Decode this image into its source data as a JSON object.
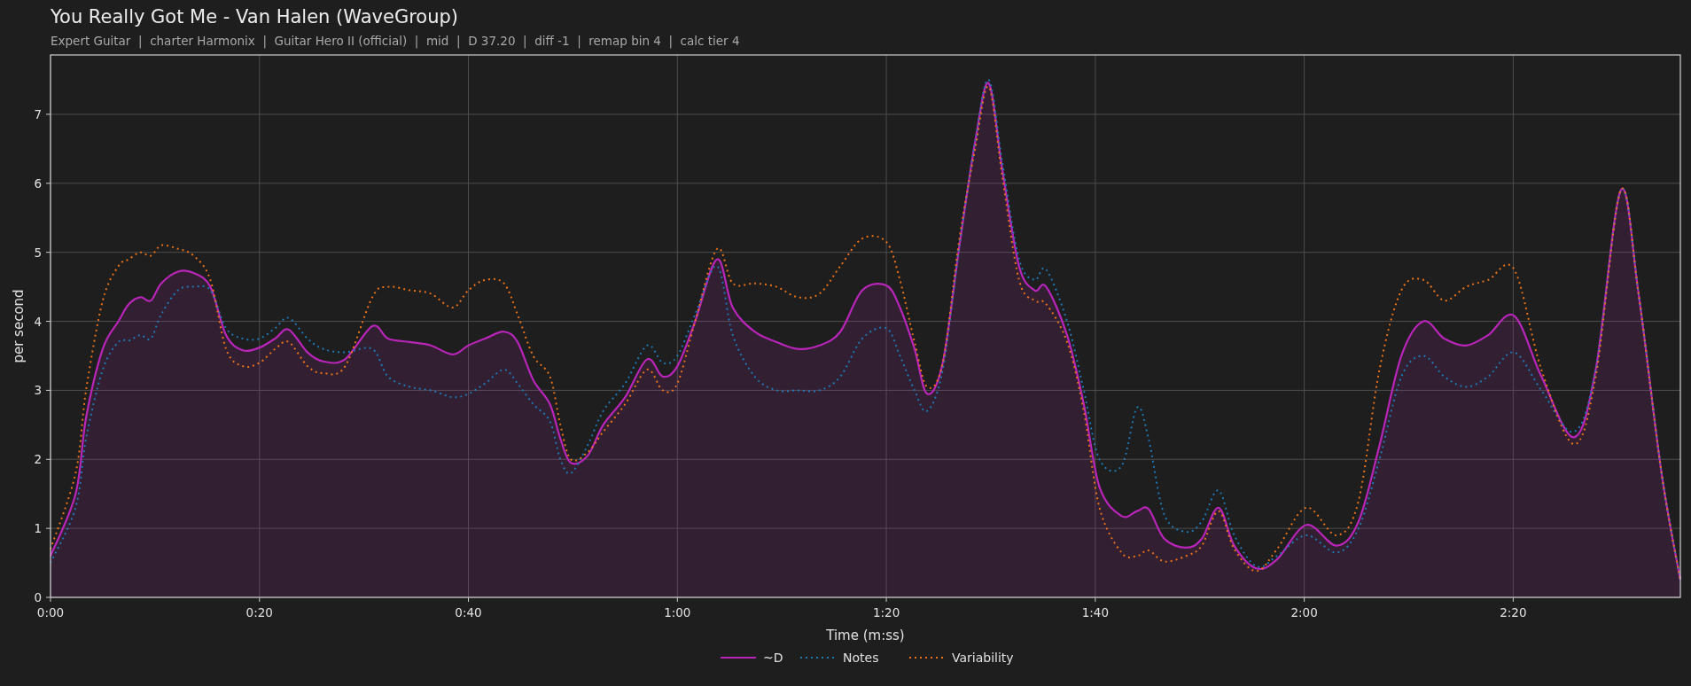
{
  "title": "You Really Got Me - Van Halen (WaveGroup)",
  "subtitle": "Expert Guitar  |  charter Harmonix  |  Guitar Hero II (official)  |  mid  |  D 37.20  |  diff -1  |  remap bin 4  |  calc tier 4",
  "chart_data": {
    "type": "line",
    "xlabel": "Time (m:ss)",
    "ylabel": "per second",
    "xlim": [
      0,
      156
    ],
    "ylim": [
      0,
      7.86
    ],
    "xticks": [
      {
        "value": 0,
        "label": "0:00"
      },
      {
        "value": 20,
        "label": "0:20"
      },
      {
        "value": 40,
        "label": "0:40"
      },
      {
        "value": 60,
        "label": "1:00"
      },
      {
        "value": 80,
        "label": "1:20"
      },
      {
        "value": 100,
        "label": "1:40"
      },
      {
        "value": 120,
        "label": "2:00"
      },
      {
        "value": 140,
        "label": "2:20"
      }
    ],
    "yticks": [
      0,
      1,
      2,
      3,
      4,
      5,
      6,
      7
    ],
    "grid": true,
    "legend": true,
    "x": [
      0,
      2.4,
      3.4,
      5,
      6.5,
      7.5,
      8.6,
      9.6,
      10.6,
      12.2,
      13.7,
      15.3,
      16.8,
      18.4,
      20,
      21.5,
      22.8,
      24.6,
      26.1,
      28.2,
      30.8,
      32.3,
      34.4,
      36.4,
      38.5,
      40,
      41.6,
      43.4,
      44.7,
      46.2,
      47.8,
      48.8,
      49.8,
      51.4,
      52.9,
      55,
      57.1,
      58.6,
      60,
      61.7,
      63.8,
      65.3,
      67.4,
      69.5,
      71.5,
      73.6,
      75.6,
      77.7,
      80,
      81.3,
      82.7,
      83.9,
      85.4,
      87,
      88.5,
      89.8,
      91.1,
      92.7,
      94.2,
      95.3,
      97.3,
      98.9,
      100.4,
      102.5,
      104,
      105.1,
      106.6,
      108.7,
      110.2,
      111.8,
      113.3,
      115.4,
      117.4,
      120.2,
      123.1,
      125.2,
      127.2,
      129.3,
      131.4,
      133.4,
      135.5,
      137.6,
      140.1,
      142.7,
      145.8,
      147.9,
      150.3,
      152,
      154.2,
      156
    ],
    "series": [
      {
        "name": "~D",
        "color": "#b825b8",
        "type": "area",
        "line_style": "solid",
        "values": [
          0.6,
          1.5,
          2.6,
          3.6,
          4.0,
          4.25,
          4.35,
          4.3,
          4.55,
          4.72,
          4.7,
          4.5,
          3.8,
          3.58,
          3.62,
          3.75,
          3.88,
          3.55,
          3.42,
          3.45,
          3.93,
          3.75,
          3.7,
          3.65,
          3.52,
          3.65,
          3.75,
          3.85,
          3.7,
          3.15,
          2.8,
          2.3,
          1.95,
          2.05,
          2.5,
          2.9,
          3.45,
          3.2,
          3.35,
          4.0,
          4.9,
          4.2,
          3.85,
          3.7,
          3.6,
          3.65,
          3.85,
          4.45,
          4.52,
          4.2,
          3.6,
          2.95,
          3.4,
          5.1,
          6.6,
          7.45,
          6.2,
          4.8,
          4.45,
          4.5,
          3.8,
          2.8,
          1.6,
          1.18,
          1.25,
          1.28,
          0.85,
          0.72,
          0.85,
          1.3,
          0.75,
          0.42,
          0.55,
          1.05,
          0.75,
          1.1,
          2.2,
          3.5,
          4.0,
          3.75,
          3.65,
          3.8,
          4.08,
          3.2,
          2.32,
          3.3,
          5.9,
          4.4,
          1.8,
          0.25
        ]
      },
      {
        "name": "Notes",
        "color": "#1f77b4",
        "line_style": "dotted",
        "values": [
          0.5,
          1.3,
          2.3,
          3.3,
          3.7,
          3.72,
          3.8,
          3.75,
          4.1,
          4.45,
          4.5,
          4.45,
          3.9,
          3.75,
          3.75,
          3.9,
          4.05,
          3.75,
          3.6,
          3.55,
          3.6,
          3.2,
          3.05,
          3.0,
          2.9,
          2.95,
          3.1,
          3.3,
          3.1,
          2.8,
          2.55,
          2.0,
          1.8,
          2.2,
          2.7,
          3.1,
          3.65,
          3.4,
          3.5,
          4.1,
          4.8,
          3.8,
          3.2,
          3.0,
          3.0,
          3.0,
          3.2,
          3.75,
          3.9,
          3.5,
          3.0,
          2.7,
          3.3,
          5.1,
          6.6,
          7.5,
          6.3,
          4.9,
          4.6,
          4.75,
          4.0,
          3.0,
          2.0,
          1.9,
          2.75,
          2.3,
          1.2,
          0.95,
          1.1,
          1.55,
          0.9,
          0.45,
          0.6,
          0.9,
          0.65,
          1.0,
          2.0,
          3.2,
          3.5,
          3.2,
          3.05,
          3.2,
          3.55,
          3.0,
          2.4,
          3.3,
          5.9,
          4.4,
          1.8,
          0.25
        ]
      },
      {
        "name": "Variability",
        "color": "#e8711a",
        "line_style": "dotted",
        "values": [
          0.7,
          1.8,
          3.0,
          4.3,
          4.8,
          4.9,
          5.0,
          4.95,
          5.1,
          5.05,
          4.95,
          4.6,
          3.6,
          3.35,
          3.4,
          3.6,
          3.7,
          3.35,
          3.25,
          3.35,
          4.35,
          4.5,
          4.45,
          4.4,
          4.2,
          4.45,
          4.6,
          4.55,
          4.1,
          3.5,
          3.2,
          2.5,
          2.0,
          2.1,
          2.4,
          2.8,
          3.3,
          3.0,
          3.1,
          4.0,
          5.05,
          4.55,
          4.55,
          4.5,
          4.35,
          4.4,
          4.8,
          5.2,
          5.15,
          4.6,
          3.7,
          3.05,
          3.4,
          5.2,
          6.5,
          7.4,
          6.1,
          4.6,
          4.3,
          4.25,
          3.7,
          2.7,
          1.3,
          0.65,
          0.6,
          0.68,
          0.52,
          0.6,
          0.75,
          1.25,
          0.7,
          0.38,
          0.7,
          1.3,
          0.9,
          1.4,
          3.3,
          4.45,
          4.6,
          4.3,
          4.5,
          4.6,
          4.75,
          3.3,
          2.22,
          3.2,
          5.9,
          4.4,
          1.8,
          0.25
        ]
      }
    ]
  }
}
